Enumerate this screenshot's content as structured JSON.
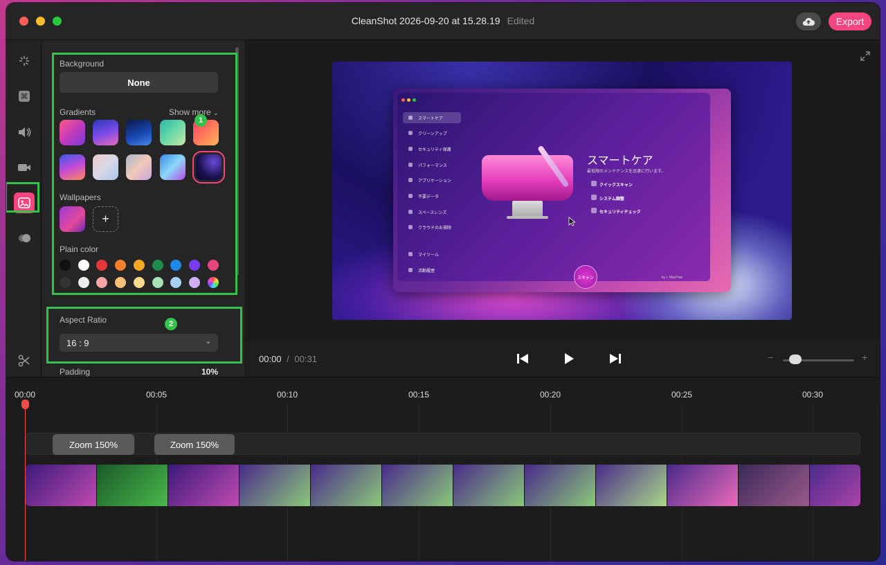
{
  "window": {
    "title": "CleanShot 2026-09-20 at 15.28.19",
    "edited_label": "Edited",
    "export_label": "Export"
  },
  "sidebar": {
    "items": [
      {
        "icon": "sparkle-cursor-icon"
      },
      {
        "icon": "command-key-icon"
      },
      {
        "icon": "speaker-icon"
      },
      {
        "icon": "video-camera-icon"
      },
      {
        "icon": "image-icon",
        "active": true
      },
      {
        "icon": "toggle-record-icon"
      },
      {
        "icon": "scissors-icon"
      }
    ]
  },
  "panel": {
    "background_label": "Background",
    "none_label": "None",
    "gradients_label": "Gradients",
    "show_more_label": "Show more",
    "badge_1": "1",
    "badge_2": "2",
    "wallpapers_label": "Wallpapers",
    "add_wallpaper": "+",
    "plain_color_label": "Plain color",
    "aspect_ratio_label": "Aspect Ratio",
    "aspect_ratio_value": "16 : 9",
    "padding_label": "Padding",
    "padding_value": "10%",
    "plain_colors_row1": [
      "#111111",
      "#ffffff",
      "#e5383b",
      "#f2802a",
      "#f5a623",
      "#1f8a4c",
      "#1e88e5",
      "#7a3cf0",
      "#e8457f"
    ],
    "plain_colors_row2": [
      "#333333",
      "#eeeeee",
      "#f5a5a5",
      "#f8c07a",
      "#fbd98a",
      "#a8e0b8",
      "#a8cff5",
      "#d0b0f5",
      "rainbow"
    ]
  },
  "preview": {
    "app_sidebar_items": [
      "スマートケア",
      "クリーンアップ",
      "セキュリティ保護",
      "パフォーマンス",
      "アプリケーション",
      "不要データ",
      "スペースレンズ",
      "クラウドのお掃除",
      "マイツール",
      "活動履歴"
    ],
    "app_heading": "スマートケア",
    "app_subtitle": "最低限のメンテナンスを迅速に行います。",
    "app_features": [
      "クイックスキャン",
      "システム調整",
      "セキュリティチェック"
    ],
    "scan_button": "スキャン",
    "by_label": "by ◐ MacPaw"
  },
  "playback": {
    "current_time": "00:00",
    "separator": "/",
    "duration": "00:31",
    "zoom_minus": "−",
    "zoom_plus": "+"
  },
  "timeline": {
    "ticks": [
      "00:00",
      "00:05",
      "00:10",
      "00:15",
      "00:20",
      "00:25",
      "00:30"
    ],
    "zoom_clips": [
      "Zoom 150%",
      "Zoom 150%"
    ]
  }
}
